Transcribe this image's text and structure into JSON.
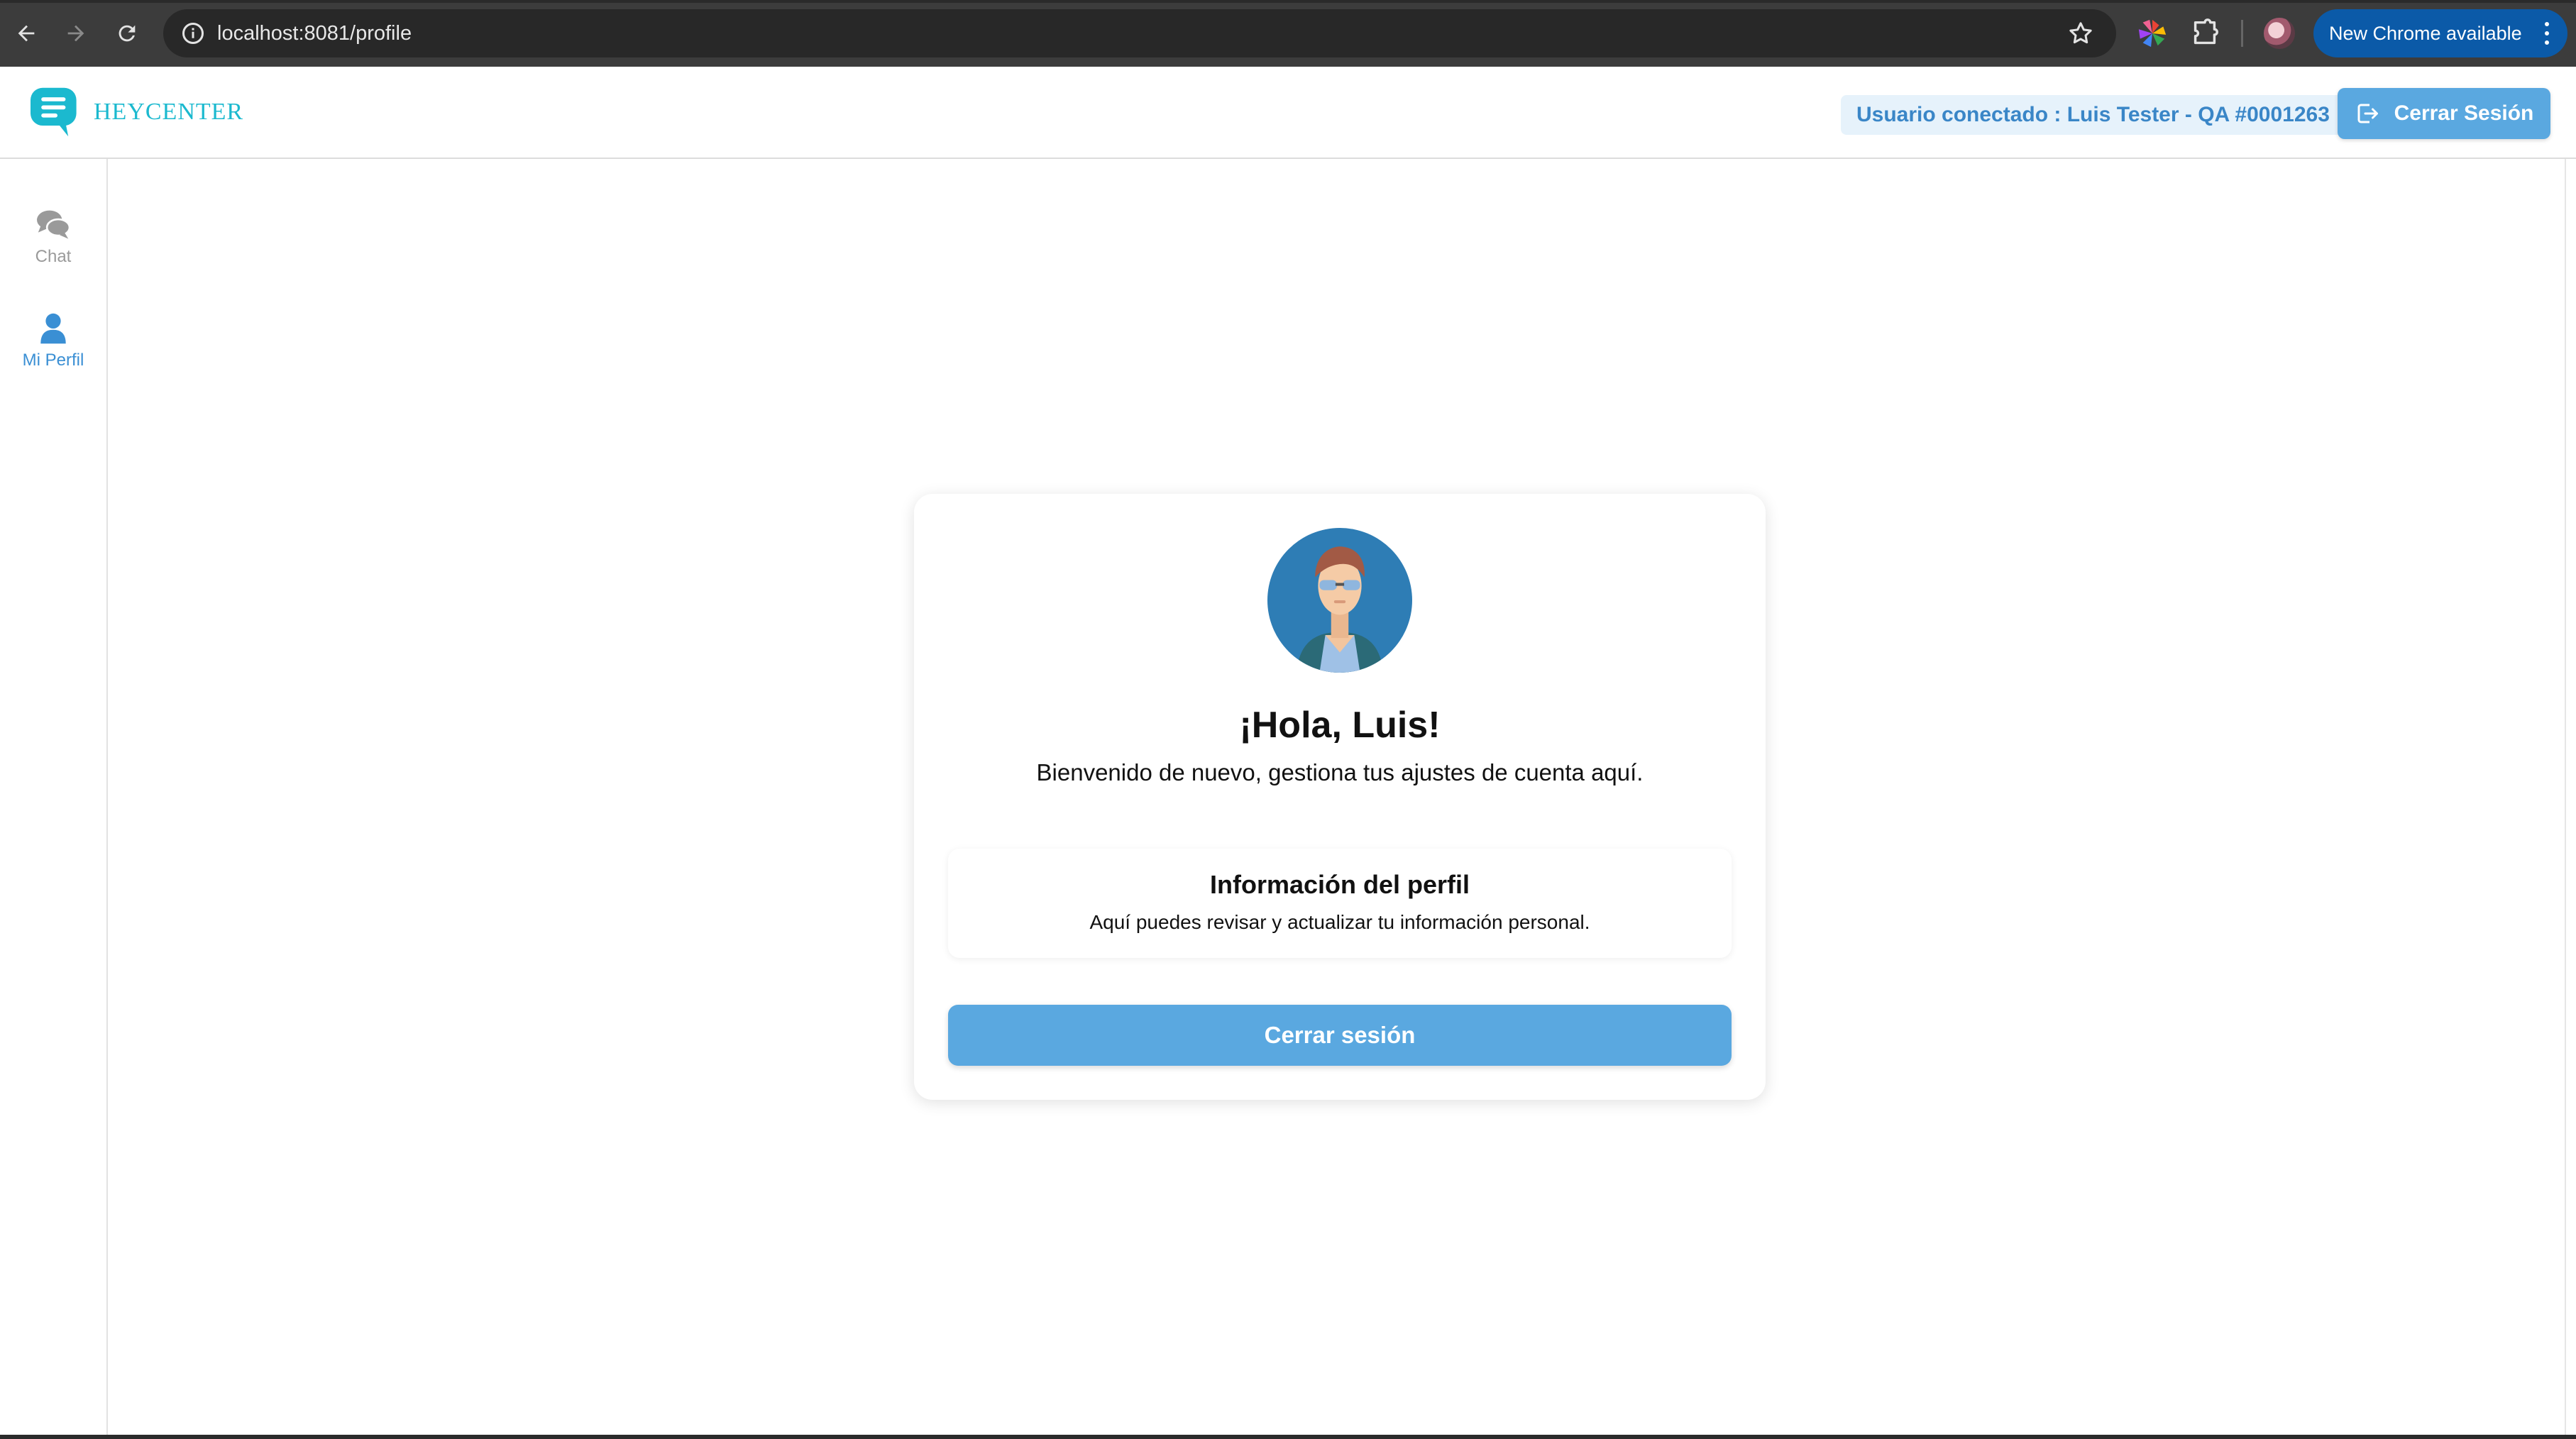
{
  "browser": {
    "url": "localhost:8081/profile",
    "update_label": "New Chrome available"
  },
  "header": {
    "logo_text": "HEYCENTER",
    "user_chip": "Usuario conectado : Luis Tester - QA #0001263",
    "logout_label": "Cerrar Sesión"
  },
  "sidebar": {
    "items": [
      {
        "label": "Chat",
        "icon": "chat-icon",
        "active": false
      },
      {
        "label": "Mi Perfil",
        "icon": "user-icon",
        "active": true
      }
    ]
  },
  "profile": {
    "greeting": "¡Hola, Luis!",
    "welcome": "Bienvenido de nuevo, gestiona tus ajustes de cuenta aquí.",
    "info_title": "Información del perfil",
    "info_desc": "Aquí puedes revisar y actualizar tu información personal.",
    "logout_label": "Cerrar sesión"
  },
  "colors": {
    "accent": "#5aa8e0",
    "brand": "#1bb9cf",
    "chip_bg": "#e6f2fb",
    "chip_text": "#3a86c7"
  }
}
